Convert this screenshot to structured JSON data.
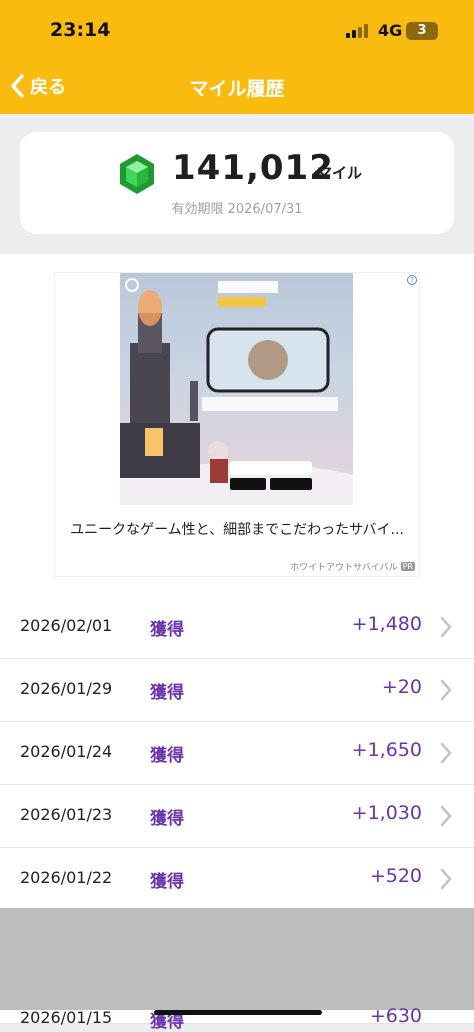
{
  "status_bar": {
    "time": "23:14",
    "network": "4G",
    "battery": "3"
  },
  "nav": {
    "back_label": "戻る",
    "title": "マイル履歴"
  },
  "miles": {
    "value": "141,012",
    "unit": "マイル",
    "expiry": "有効期限 2026/07/31"
  },
  "ad": {
    "text": "ユニークなゲーム性と、細部までこだわったサバイ...",
    "source": "ホワイトアウトサバイバル",
    "badge": "PR",
    "help": "?"
  },
  "history": [
    {
      "date": "2026/02/01",
      "type": "獲得",
      "amount": "+1,480"
    },
    {
      "date": "2026/01/29",
      "type": "獲得",
      "amount": "+20"
    },
    {
      "date": "2026/01/24",
      "type": "獲得",
      "amount": "+1,650"
    },
    {
      "date": "2026/01/23",
      "type": "獲得",
      "amount": "+1,030"
    },
    {
      "date": "2026/01/22",
      "type": "獲得",
      "amount": "+520"
    },
    {
      "date": "2026/01/15",
      "type": "獲得",
      "amount": "+630"
    }
  ],
  "colors": {
    "header": "#f9bb0f",
    "accent": "#6a34b0",
    "gem": "#2fc94a"
  }
}
